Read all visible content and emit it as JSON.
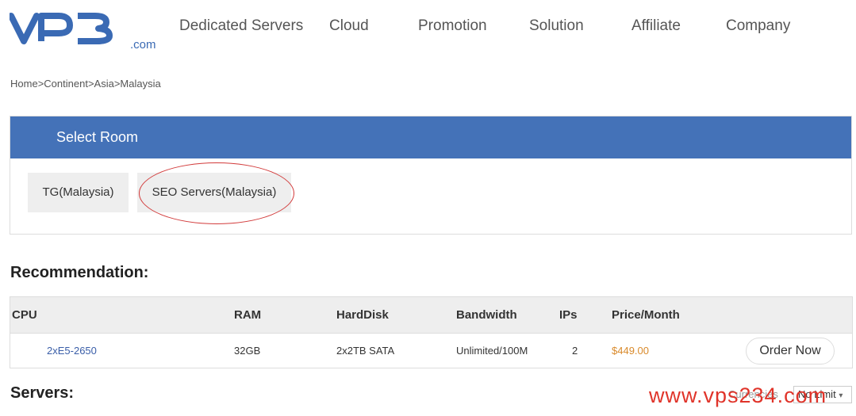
{
  "header": {
    "logo_text": "VPB",
    "logo_suffix": ".com",
    "nav": [
      "Dedicated Servers",
      "Cloud",
      "Promotion",
      "Solution",
      "Affiliate",
      "Company"
    ]
  },
  "breadcrumb": [
    "Home",
    ">",
    "Continent",
    ">",
    "Asia",
    ">",
    "Malaysia"
  ],
  "room": {
    "title": "Select Room",
    "options": [
      "TG(Malaysia)",
      "SEO Servers(Malaysia)"
    ],
    "highlight_color": "#d23a3a"
  },
  "recommendation": {
    "title": "Recommendation:",
    "columns": [
      "CPU",
      "RAM",
      "HardDisk",
      "Bandwidth",
      "IPs",
      "Price/Month"
    ],
    "rows": [
      {
        "cpu": "2xE5-2650",
        "ram": "32GB",
        "disk": "2x2TB SATA",
        "bandwidth": "Unlimited/100M",
        "ips": "2",
        "price": "$449.00",
        "action": "Order Now"
      }
    ]
  },
  "servers": {
    "title": "Servers:",
    "currency_label": "Currencies",
    "filter_value": "No Limit"
  },
  "watermark": "www.vps234.com",
  "colors": {
    "accent": "#4472b8",
    "price": "#d98a2b",
    "link": "#3a5ea8",
    "watermark": "#e0342a"
  }
}
